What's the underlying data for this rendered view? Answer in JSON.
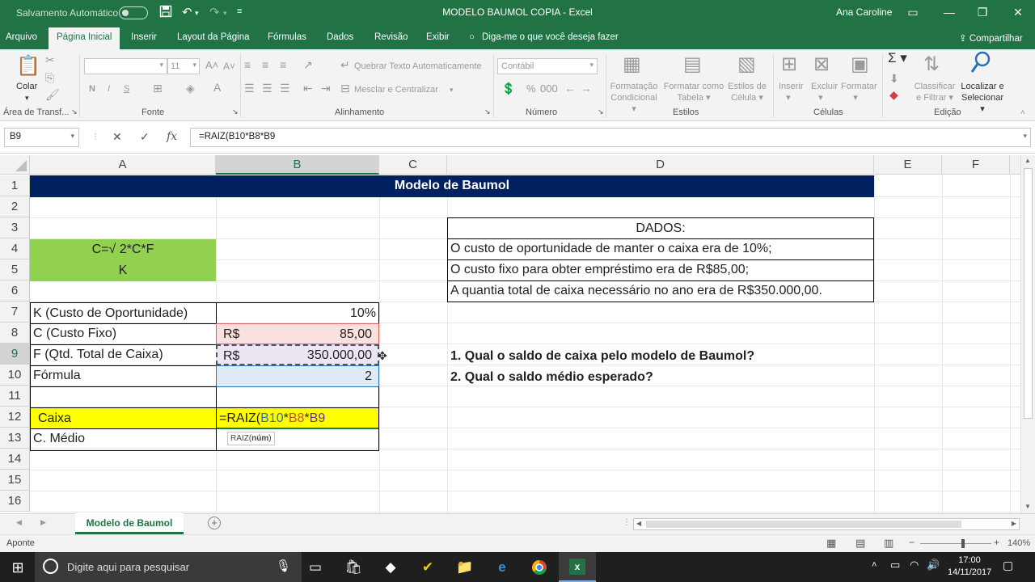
{
  "titlebar": {
    "autosave": "Salvamento Automático",
    "title": "MODELO BAUMOL COPIA  -  Excel",
    "user": "Ana Caroline",
    "save_icon": "save-icon",
    "undo_icon": "undo-icon",
    "redo_icon": "redo-icon"
  },
  "menu": {
    "tabs": [
      "Arquivo",
      "Página Inicial",
      "Inserir",
      "Layout da Página",
      "Fórmulas",
      "Dados",
      "Revisão",
      "Exibir"
    ],
    "active_tab": "Página Inicial",
    "tellme": "Diga-me o que você deseja fazer",
    "share": "Compartilhar"
  },
  "ribbon": {
    "paste": "Colar",
    "clipboard": "Área de Transf...",
    "font_group": "Fonte",
    "font_size": "11",
    "bold": "N",
    "italic": "I",
    "underline": "S",
    "wrap_text": "Quebrar Texto Automaticamente",
    "merge_center": "Mesclar e Centralizar",
    "alignment_group": "Alinhamento",
    "number_format": "Contábil",
    "number_group": "Número",
    "cond_format": [
      "Formatação",
      "Condicional"
    ],
    "format_table": [
      "Formatar como",
      "Tabela"
    ],
    "cell_styles": [
      "Estilos de",
      "Célula"
    ],
    "styles_group": "Estilos",
    "insert": "Inserir",
    "delete": "Excluir",
    "format": "Formatar",
    "cells_group": "Células",
    "sort_filter": [
      "Classificar",
      "e Filtrar"
    ],
    "find_select": [
      "Localizar e",
      "Selecionar"
    ],
    "editing_group": "Edição"
  },
  "formula_bar": {
    "name_box": "B9",
    "cancel": "✕",
    "enter": "✓",
    "fx": "fx",
    "formula": "=RAIZ(B10*B8*B9"
  },
  "sheet": {
    "columns": [
      "A",
      "B",
      "C",
      "D",
      "E",
      "F"
    ],
    "rows": [
      "1",
      "2",
      "3",
      "4",
      "5",
      "6",
      "7",
      "8",
      "9",
      "10",
      "11",
      "12",
      "13",
      "14",
      "15",
      "16"
    ],
    "title": "Modelo de Baumol",
    "formula_c": "C=√ 2*C*F",
    "formula_k": "K",
    "dados_header": "DADOS:",
    "dados": [
      "O custo de oportunidade de manter o caixa era de 10%;",
      "O custo fixo para obter empréstimo era de R$85,00;",
      "A quantia total de caixa necessário no ano era de R$350.000,00."
    ],
    "labels": {
      "k": "K (Custo de Oportunidade)",
      "c": "C (Custo Fixo)",
      "f": "F (Qtd. Total de Caixa)",
      "formula": "Fórmula",
      "caixa": "Caixa",
      "c_medio": "C. Médio"
    },
    "values": {
      "k": "10%",
      "currency": "R$",
      "c": "85,00",
      "f": "350.000,00",
      "formula": "2"
    },
    "edit_formula": {
      "prefix": "=RAIZ(",
      "ref1": "B10",
      "op1": "*",
      "ref2": "B8",
      "op2": "*",
      "ref3": "B9"
    },
    "tooltip": {
      "func": "RAIZ(",
      "arg": "núm",
      "close": ")"
    },
    "questions": [
      "1. Qual o saldo de caixa pelo modelo de Baumol?",
      "2. Qual o saldo médio esperado?"
    ]
  },
  "sheet_tabs": {
    "active": "Modelo de Baumol"
  },
  "status": {
    "mode": "Aponte",
    "zoom": "140%"
  },
  "taskbar": {
    "search": "Digite aqui para pesquisar",
    "time": "17:00",
    "date": "14/11/2017"
  },
  "colors": {
    "excel_green": "#217346",
    "title_fill": "#002060",
    "green_fill": "#92d050",
    "yellow_fill": "#ffff00"
  }
}
